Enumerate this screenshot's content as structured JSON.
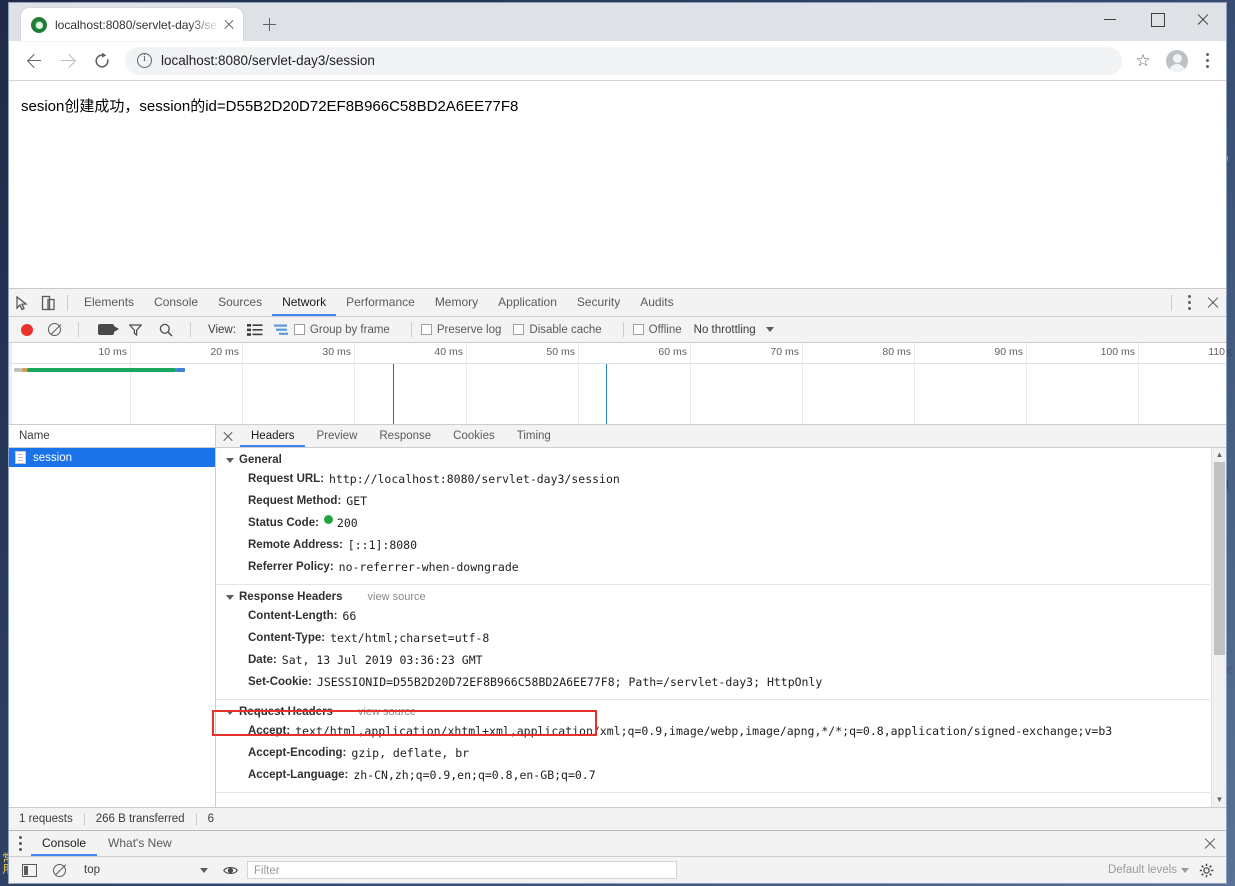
{
  "browser": {
    "tab": {
      "title": "localhost:8080/servlet-day3/se",
      "favicon": "globe-icon"
    },
    "new_tab_label": "+",
    "window_controls": {
      "minimize": "—",
      "maximize": "□",
      "close": "✕"
    },
    "omnibox": {
      "url_prefix": "localhost:8080",
      "url_path": "/servlet-day3/session",
      "full_url": "localhost:8080/servlet-day3/session"
    }
  },
  "page": {
    "body_text": "sesion创建成功，session的id=D55B2D20D72EF8B966C58BD2A6EE77F8"
  },
  "devtools": {
    "panels": [
      "Elements",
      "Console",
      "Sources",
      "Network",
      "Performance",
      "Memory",
      "Application",
      "Security",
      "Audits"
    ],
    "active_panel": "Network",
    "network_toolbar": {
      "view_label": "View:",
      "group_by_frame": "Group by frame",
      "preserve_log": "Preserve log",
      "disable_cache": "Disable cache",
      "offline": "Offline",
      "throttling": "No throttling"
    },
    "overview": {
      "ticks": [
        "10 ms",
        "20 ms",
        "30 ms",
        "40 ms",
        "50 ms",
        "60 ms",
        "70 ms",
        "80 ms",
        "90 ms",
        "100 ms",
        "110"
      ],
      "request_bar": {
        "start_ms": 0.5,
        "end_ms": 17.0,
        "color": "#1aa65c"
      },
      "dom_content_loaded_ms": 38.0,
      "dom_content_loaded_color": "#b33a32",
      "load_event_ms": 60.0,
      "load_event_color": "#2b7fc4"
    },
    "request_list": {
      "column_header": "Name",
      "rows": [
        {
          "name": "session",
          "icon": "document-icon",
          "selected": true
        }
      ]
    },
    "detail_tabs": [
      "Headers",
      "Preview",
      "Response",
      "Cookies",
      "Timing"
    ],
    "active_detail_tab": "Headers",
    "view_source_label": "view source",
    "sections": [
      {
        "title": "General",
        "has_view_source": false,
        "rows": [
          {
            "key": "Request URL:",
            "value": "http://localhost:8080/servlet-day3/session"
          },
          {
            "key": "Request Method:",
            "value": "GET"
          },
          {
            "key": "Status Code:",
            "value": "200",
            "status_dot": true
          },
          {
            "key": "Remote Address:",
            "value": "[::1]:8080"
          },
          {
            "key": "Referrer Policy:",
            "value": "no-referrer-when-downgrade"
          }
        ]
      },
      {
        "title": "Response Headers",
        "has_view_source": true,
        "rows": [
          {
            "key": "Content-Length:",
            "value": "66"
          },
          {
            "key": "Content-Type:",
            "value": "text/html;charset=utf-8"
          },
          {
            "key": "Date:",
            "value": "Sat, 13 Jul 2019 03:36:23 GMT"
          },
          {
            "key": "Set-Cookie:",
            "value": "JSESSIONID=D55B2D20D72EF8B966C58BD2A6EE77F8; Path=/servlet-day3; HttpOnly",
            "highlighted": true
          }
        ]
      },
      {
        "title": "Request Headers",
        "has_view_source": true,
        "rows": [
          {
            "key": "Accept:",
            "value": "text/html,application/xhtml+xml,application/xml;q=0.9,image/webp,image/apng,*/*;q=0.8,application/signed-exchange;v=b3"
          },
          {
            "key": "Accept-Encoding:",
            "value": "gzip, deflate, br"
          },
          {
            "key": "Accept-Language:",
            "value": "zh-CN,zh;q=0.9,en;q=0.8,en-GB;q=0.7"
          }
        ]
      }
    ],
    "status_bar": {
      "requests": "1 requests",
      "transferred": "266 B transferred",
      "resources": "6"
    },
    "drawer": {
      "tabs": [
        "Console",
        "What's New"
      ],
      "active_tab": "Console",
      "context": "top",
      "filter_placeholder": "Filter",
      "levels": "Default levels"
    }
  },
  "colors": {
    "accent": "#4285f4",
    "selection": "#1a73e8",
    "highlight_box": "#e63329",
    "record_active": "#e8322b",
    "status_ok": "#25a244"
  }
}
